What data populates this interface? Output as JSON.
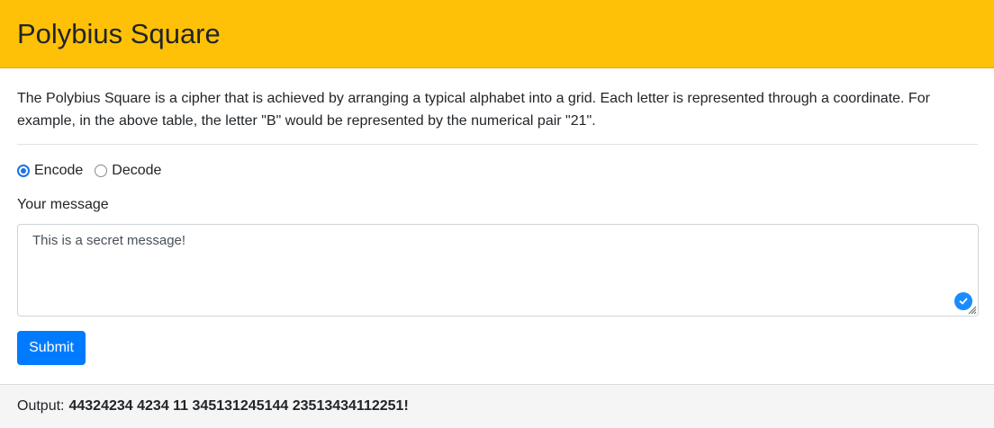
{
  "header": {
    "title": "Polybius Square"
  },
  "intro": {
    "text": "The Polybius Square is a cipher that is achieved by arranging a typical alphabet into a grid. Each letter is represented through a coordinate. For example, in the above table, the letter \"B\" would be represented by the numerical pair \"21\"."
  },
  "mode": {
    "options": [
      {
        "label": "Encode",
        "checked": true
      },
      {
        "label": "Decode",
        "checked": false
      }
    ]
  },
  "message": {
    "label": "Your message",
    "value": "This is a secret message!"
  },
  "form": {
    "submit_label": "Submit"
  },
  "output": {
    "label": "Output:",
    "value": "44324234 4234 11 345131245144 23513434112251!"
  },
  "colors": {
    "header_bg": "#ffc107",
    "primary": "#007bff",
    "radio_accent": "#1a73e8"
  }
}
